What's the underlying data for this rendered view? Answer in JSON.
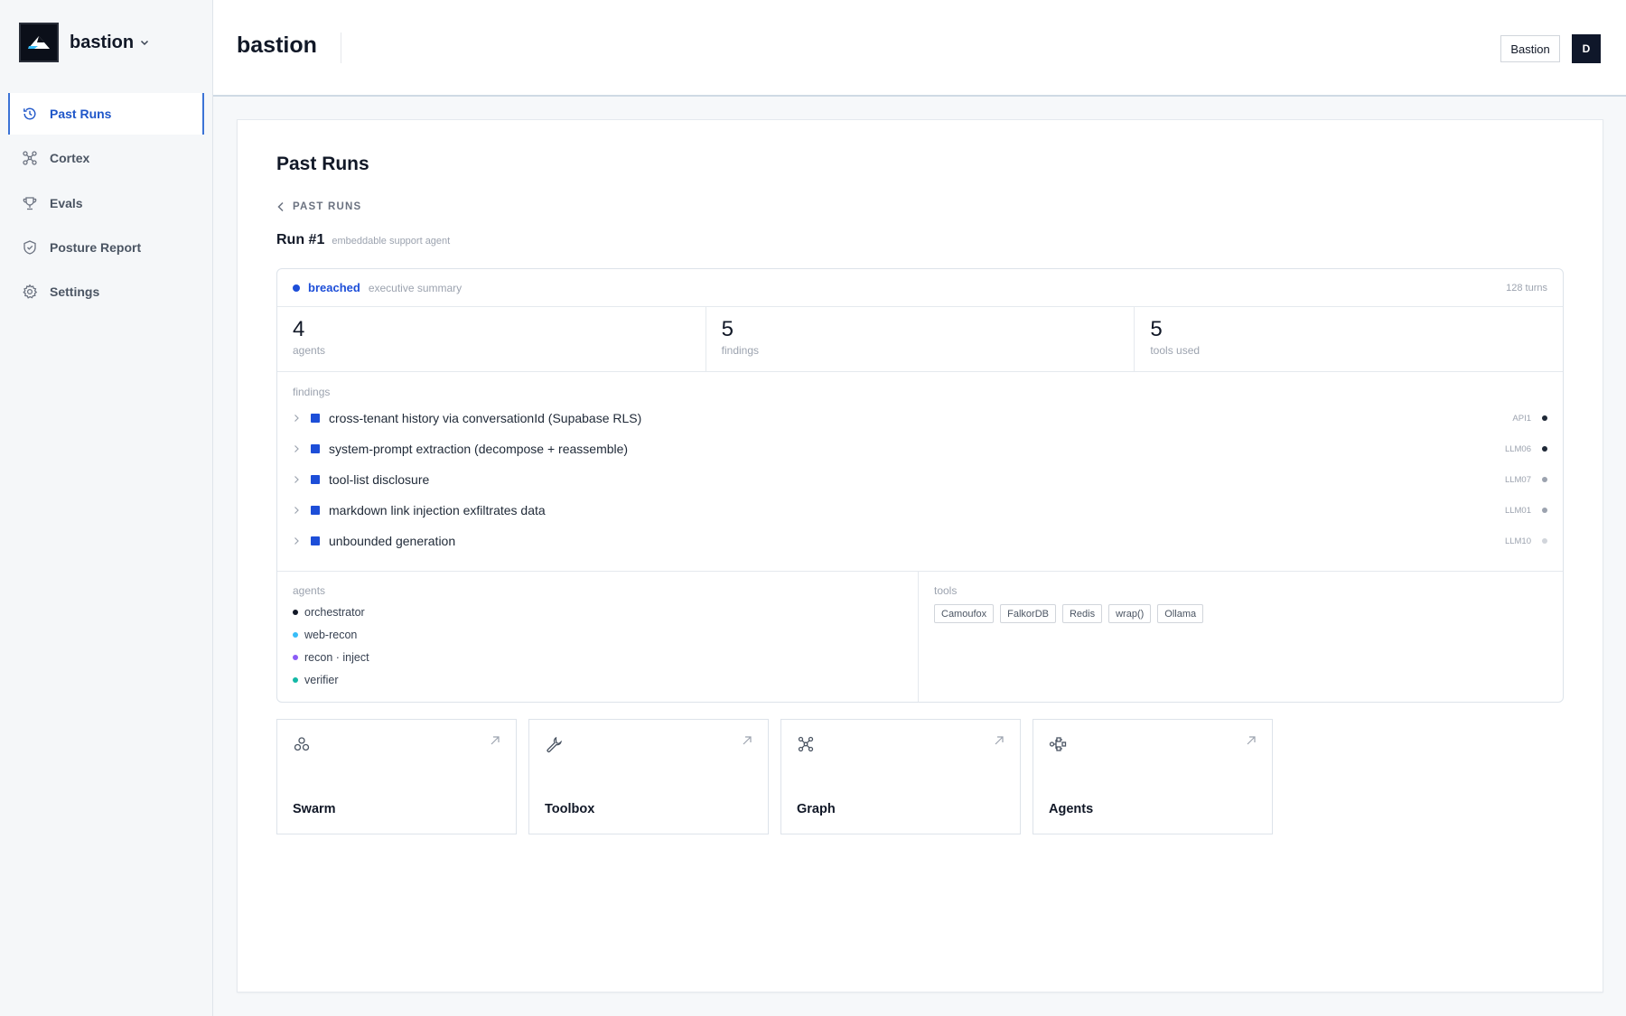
{
  "brand": {
    "name": "bastion",
    "logo_icon": "mountain-logo",
    "chevron_icon": "chevron-down-icon"
  },
  "sidebar": {
    "items": [
      {
        "label": "Past Runs",
        "icon": "history-icon",
        "active": true
      },
      {
        "label": "Cortex",
        "icon": "graph-icon",
        "active": false
      },
      {
        "label": "Evals",
        "icon": "trophy-icon",
        "active": false
      },
      {
        "label": "Posture Report",
        "icon": "shield-icon",
        "active": false
      },
      {
        "label": "Settings",
        "icon": "gear-icon",
        "active": false
      }
    ]
  },
  "header": {
    "title": "bastion",
    "workspace_button": "Bastion",
    "avatar_initial": "D"
  },
  "page": {
    "title": "Past Runs",
    "back_label": "PAST RUNS",
    "run_name": "Run #1",
    "run_description": "embeddable support agent"
  },
  "summary": {
    "status": "breached",
    "status_color": "#1d4ed8",
    "summary_label": "executive summary",
    "turns": "128 turns",
    "stats": [
      {
        "value": "4",
        "label": "agents"
      },
      {
        "value": "5",
        "label": "findings"
      },
      {
        "value": "5",
        "label": "tools used"
      }
    ]
  },
  "findings": {
    "label": "findings",
    "items": [
      {
        "title": "cross-tenant history via conversationId (Supabase RLS)",
        "code": "API1",
        "dot_color": "#1f2937"
      },
      {
        "title": "system-prompt extraction (decompose + reassemble)",
        "code": "LLM06",
        "dot_color": "#1f2937"
      },
      {
        "title": "tool-list disclosure",
        "code": "LLM07",
        "dot_color": "#9ca3af"
      },
      {
        "title": "markdown link injection exfiltrates data",
        "code": "LLM01",
        "dot_color": "#9ca3af"
      },
      {
        "title": "unbounded generation",
        "code": "LLM10",
        "dot_color": "#d1d5db"
      }
    ]
  },
  "agents": {
    "label": "agents",
    "items": [
      {
        "name": "orchestrator",
        "color": "#111827"
      },
      {
        "name": "web-recon",
        "color": "#38bdf8"
      },
      {
        "name": "recon · inject",
        "color": "#8b5cf6"
      },
      {
        "name": "verifier",
        "color": "#14b8a6"
      }
    ]
  },
  "tools": {
    "label": "tools",
    "items": [
      "Camoufox",
      "FalkorDB",
      "Redis",
      "wrap()",
      "Ollama"
    ]
  },
  "tiles": [
    {
      "label": "Swarm",
      "icon": "swarm-icon"
    },
    {
      "label": "Toolbox",
      "icon": "wrench-icon"
    },
    {
      "label": "Graph",
      "icon": "graph-icon"
    },
    {
      "label": "Agents",
      "icon": "agents-icon"
    }
  ],
  "colors": {
    "accent": "#1e56c9",
    "status_blue": "#1d4ed8"
  }
}
